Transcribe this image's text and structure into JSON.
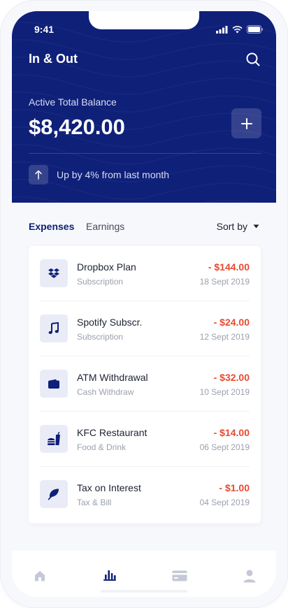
{
  "status_bar": {
    "time": "9:41"
  },
  "header": {
    "app_title": "In & Out",
    "balance_label": "Active Total Balance",
    "balance_value": "$8,420.00",
    "trend_text": "Up by 4% from last month"
  },
  "tabs": {
    "expenses_label": "Expenses",
    "earnings_label": "Earnings",
    "sort_label": "Sort by"
  },
  "transactions": [
    {
      "name": "Dropbox Plan",
      "category": "Subscription",
      "amount": "- $144.00",
      "date": "18 Sept 2019",
      "icon": "dropbox-icon"
    },
    {
      "name": "Spotify Subscr.",
      "category": "Subscription",
      "amount": "- $24.00",
      "date": "12 Sept 2019",
      "icon": "music-note-icon"
    },
    {
      "name": "ATM Withdrawal",
      "category": "Cash Withdraw",
      "amount": "- $32.00",
      "date": "10 Sept 2019",
      "icon": "wallet-icon"
    },
    {
      "name": "KFC Restaurant",
      "category": "Food & Drink",
      "amount": "- $14.00",
      "date": "06 Sept 2019",
      "icon": "fast-food-icon"
    },
    {
      "name": "Tax on Interest",
      "category": "Tax & Bill",
      "amount": "- $1.00",
      "date": "04 Sept 2019",
      "icon": "leaf-icon"
    }
  ],
  "bottom_nav": [
    {
      "icon": "home-icon",
      "active": false
    },
    {
      "icon": "bar-chart-icon",
      "active": true
    },
    {
      "icon": "card-icon",
      "active": false
    },
    {
      "icon": "user-icon",
      "active": false
    }
  ],
  "colors": {
    "primary": "#0f2079",
    "expense": "#e84a2e",
    "muted": "#9aa0ad",
    "nav_inactive": "#c5c9d6"
  }
}
